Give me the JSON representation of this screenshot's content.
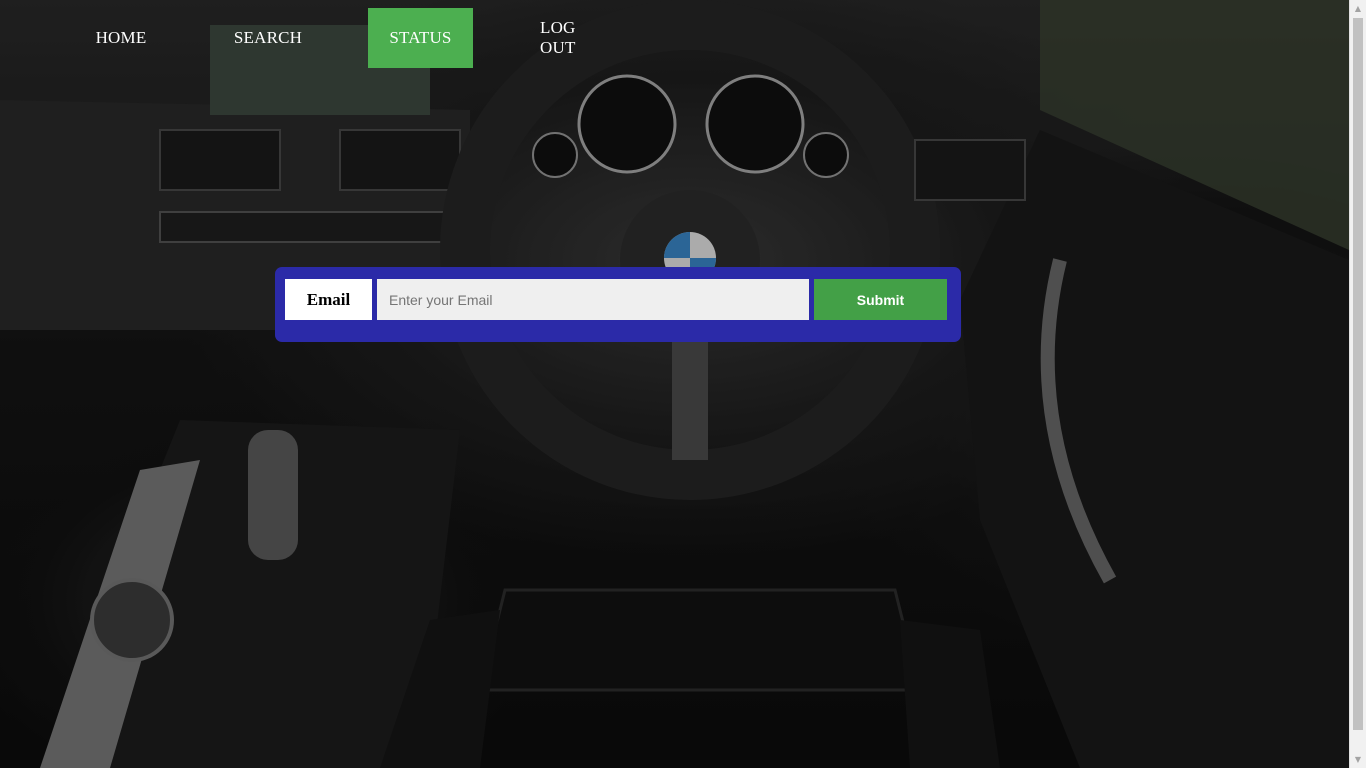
{
  "nav": {
    "items": [
      {
        "label": "HOME",
        "active": false
      },
      {
        "label": "SEARCH",
        "active": false
      },
      {
        "label": "STATUS",
        "active": true
      },
      {
        "label": "LOG OUT",
        "active": false
      }
    ],
    "active_color": "#4caf50"
  },
  "form": {
    "label": "Email",
    "input_placeholder": "Enter your Email",
    "input_value": "",
    "submit_label": "Submit",
    "panel_color": "#2b2aa8",
    "button_color": "#43a047"
  },
  "background": {
    "subject": "car interior with steering wheel and dashboard"
  }
}
